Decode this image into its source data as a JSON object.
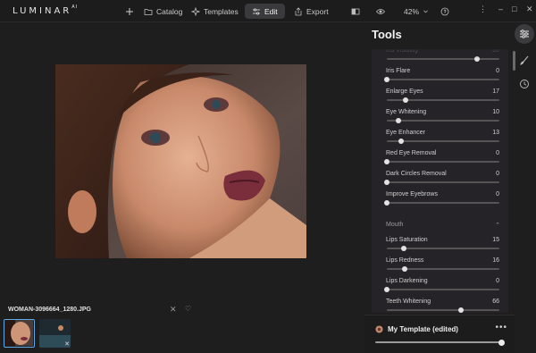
{
  "app": {
    "logo": "LUMINAR",
    "logo_sup": "AI"
  },
  "toolbar": {
    "add_icon": "plus-icon",
    "catalog_label": "Catalog",
    "templates_label": "Templates",
    "edit_label": "Edit",
    "export_label": "Export",
    "zoom_label": "42%",
    "compare_icon": "compare-icon",
    "preview_icon": "eye-icon",
    "help_icon": "help-icon"
  },
  "window_controls": {
    "more": "⋮",
    "minimize": "–",
    "maximize": "□",
    "close": "✕"
  },
  "canvas": {
    "filename": "WOMAN-3096664_1280.JPG",
    "close": "✕",
    "favorite": "♡"
  },
  "filmstrip": {
    "thumb2_close": "✕"
  },
  "tools": {
    "title": "Tools",
    "eyes_sliders": [
      {
        "label": "Iris Visibility",
        "value": "80",
        "fraction": 0.8
      },
      {
        "label": "Iris Flare",
        "value": "0",
        "fraction": 0.0
      },
      {
        "label": "Enlarge Eyes",
        "value": "17",
        "fraction": 0.17
      },
      {
        "label": "Eye Whitening",
        "value": "10",
        "fraction": 0.1
      },
      {
        "label": "Eye Enhancer",
        "value": "13",
        "fraction": 0.13
      },
      {
        "label": "Red Eye Removal",
        "value": "0",
        "fraction": 0.0
      },
      {
        "label": "Dark Circles Removal",
        "value": "0",
        "fraction": 0.0
      },
      {
        "label": "Improve Eyebrows",
        "value": "0",
        "fraction": 0.0
      }
    ],
    "mouth_section": {
      "label": "Mouth",
      "chevron": "⌃"
    },
    "mouth_sliders": [
      {
        "label": "Lips Saturation",
        "value": "15",
        "fraction": 0.15
      },
      {
        "label": "Lips Redness",
        "value": "16",
        "fraction": 0.16
      },
      {
        "label": "Lips Darkening",
        "value": "0",
        "fraction": 0.0
      },
      {
        "label": "Teeth Whitening",
        "value": "66",
        "fraction": 0.66
      }
    ]
  },
  "rail": {
    "adjust_icon": "sliders-icon",
    "brush_icon": "brush-icon",
    "history_icon": "clock-icon"
  },
  "template": {
    "name": "My Template (edited)",
    "more": "•••",
    "amount_fraction": 1.0
  }
}
